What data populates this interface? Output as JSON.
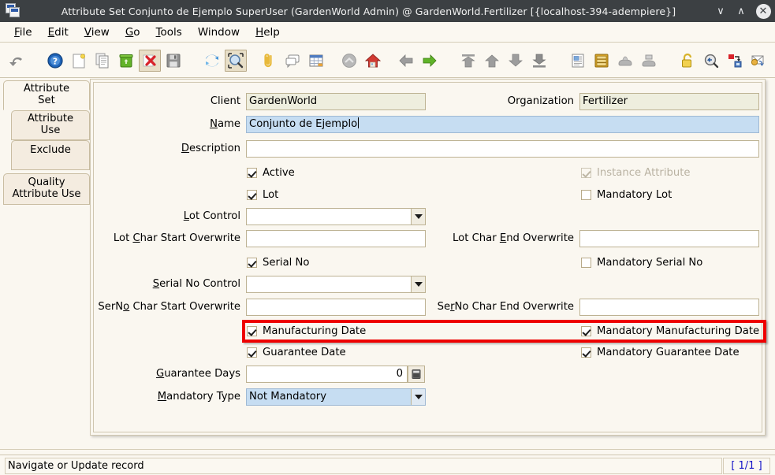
{
  "window": {
    "title": "Attribute Set Conjunto de Ejemplo SuperUser (GardenWorld Admin) @ GardenWorld.Fertilizer [{localhost-394-adempiere}]",
    "icon": "windows-stack-icon",
    "minimize": "∨",
    "maximize": "∧",
    "close": "✕"
  },
  "menubar": {
    "items": [
      {
        "label": "File",
        "mnemonic": "F"
      },
      {
        "label": "Edit",
        "mnemonic": "E"
      },
      {
        "label": "View",
        "mnemonic": "V"
      },
      {
        "label": "Go",
        "mnemonic": "G"
      },
      {
        "label": "Tools",
        "mnemonic": "T"
      },
      {
        "label": "Window",
        "mnemonic": ""
      },
      {
        "label": "Help",
        "mnemonic": "H"
      }
    ]
  },
  "toolbar": {
    "buttons": [
      {
        "name": "undo-icon",
        "selected": false
      },
      {
        "name": "help-icon",
        "selected": false
      },
      {
        "name": "new-record-icon",
        "selected": false
      },
      {
        "name": "copy-record-icon",
        "selected": false
      },
      {
        "name": "delete-icon",
        "selected": false
      },
      {
        "name": "delete-selection-icon",
        "selected": true
      },
      {
        "name": "save-icon",
        "selected": false
      },
      {
        "name": "refresh-icon",
        "selected": false
      },
      {
        "name": "find-icon",
        "selected": true
      },
      {
        "name": "attachment-icon",
        "selected": false
      },
      {
        "name": "chat-icon",
        "selected": false
      },
      {
        "name": "grid-toggle-icon",
        "selected": false
      },
      {
        "name": "parent-record-icon",
        "selected": false
      },
      {
        "name": "home-icon",
        "selected": false
      },
      {
        "name": "previous-record-icon",
        "selected": false
      },
      {
        "name": "next-record-icon",
        "selected": false
      },
      {
        "name": "first-record-icon",
        "selected": false
      },
      {
        "name": "previous-page-icon",
        "selected": false
      },
      {
        "name": "next-page-icon",
        "selected": false
      },
      {
        "name": "last-record-icon",
        "selected": false
      },
      {
        "name": "report-icon",
        "selected": false
      },
      {
        "name": "archive-icon",
        "selected": false
      },
      {
        "name": "print-preview-icon",
        "selected": false
      },
      {
        "name": "print-icon",
        "selected": false
      },
      {
        "name": "lock-icon",
        "selected": false
      },
      {
        "name": "zoom-back-icon",
        "selected": false
      },
      {
        "name": "zoom-across-icon",
        "selected": false
      },
      {
        "name": "request-icon",
        "selected": false
      },
      {
        "name": "preference-icon",
        "selected": false
      },
      {
        "name": "product-info-icon",
        "selected": false
      },
      {
        "name": "exit-icon",
        "selected": false
      }
    ]
  },
  "tabs": [
    {
      "label": "Attribute Set",
      "line1": "Attribute",
      "line2": "Set",
      "active": true
    },
    {
      "label": "Attribute Use",
      "line1": "Attribute",
      "line2": "Use",
      "active": false
    },
    {
      "label": "Exclude",
      "line1": "Exclude",
      "line2": "",
      "active": false
    },
    {
      "label": "Quality Attribute Use",
      "line1": "Quality",
      "line2": "Attribute Use",
      "active": false
    }
  ],
  "form": {
    "client": {
      "label": "Client",
      "mnemonic": "",
      "value": "GardenWorld",
      "readonly": true
    },
    "organization": {
      "label": "Organization",
      "mnemonic": "",
      "value": "Fertilizer",
      "readonly": true
    },
    "name": {
      "label": "Name",
      "mnemonic": "N",
      "value": "Conjunto de Ejemplo",
      "focused": true
    },
    "description": {
      "label": "Description",
      "mnemonic": "D",
      "value": ""
    },
    "active": {
      "label": "Active",
      "checked": true,
      "disabled": false
    },
    "instance_attribute": {
      "label": "Instance Attribute",
      "checked": true,
      "disabled": true
    },
    "lot": {
      "label": "Lot",
      "checked": true,
      "disabled": false
    },
    "mandatory_lot": {
      "label": "Mandatory Lot",
      "checked": false,
      "disabled": false
    },
    "lot_control": {
      "label": "Lot Control",
      "mnemonic": "L",
      "value": ""
    },
    "lot_char_start": {
      "label": "Lot Char Start Overwrite",
      "mnemonic": "C",
      "value": ""
    },
    "lot_char_end": {
      "label": "Lot Char End Overwrite",
      "mnemonic": "E",
      "value": ""
    },
    "serial_no": {
      "label": "Serial No",
      "checked": true,
      "disabled": false
    },
    "mandatory_serial_no": {
      "label": "Mandatory Serial No",
      "checked": false,
      "disabled": false
    },
    "serial_no_control": {
      "label": "Serial No Control",
      "mnemonic": "S",
      "value": ""
    },
    "serno_char_start": {
      "label": "SerNo Char Start Overwrite",
      "mnemonic": "N",
      "value": ""
    },
    "serno_char_end": {
      "label": "SerNo Char End Overwrite",
      "mnemonic": "r",
      "value": ""
    },
    "manufacturing_date": {
      "label": "Manufacturing Date",
      "checked": true,
      "disabled": false
    },
    "mandatory_manufacturing_date": {
      "label": "Mandatory Manufacturing Date",
      "checked": true,
      "disabled": false
    },
    "guarantee_date": {
      "label": "Guarantee Date",
      "checked": true,
      "disabled": false
    },
    "mandatory_guarantee_date": {
      "label": "Mandatory Guarantee Date",
      "checked": true,
      "disabled": false
    },
    "guarantee_days": {
      "label": "Guarantee Days",
      "mnemonic": "G",
      "value": "0",
      "button_icon": "calculator-icon"
    },
    "mandatory_type": {
      "label": "Mandatory Type",
      "mnemonic": "M",
      "value": "Not Mandatory",
      "focused": true
    }
  },
  "statusbar": {
    "message": "Navigate or Update record",
    "record_count": "[ 1/1 ]",
    "count_color": "#1414c8"
  },
  "annotation": {
    "highlight_color": "#ee0000",
    "target": "manufacturing-date-row"
  }
}
